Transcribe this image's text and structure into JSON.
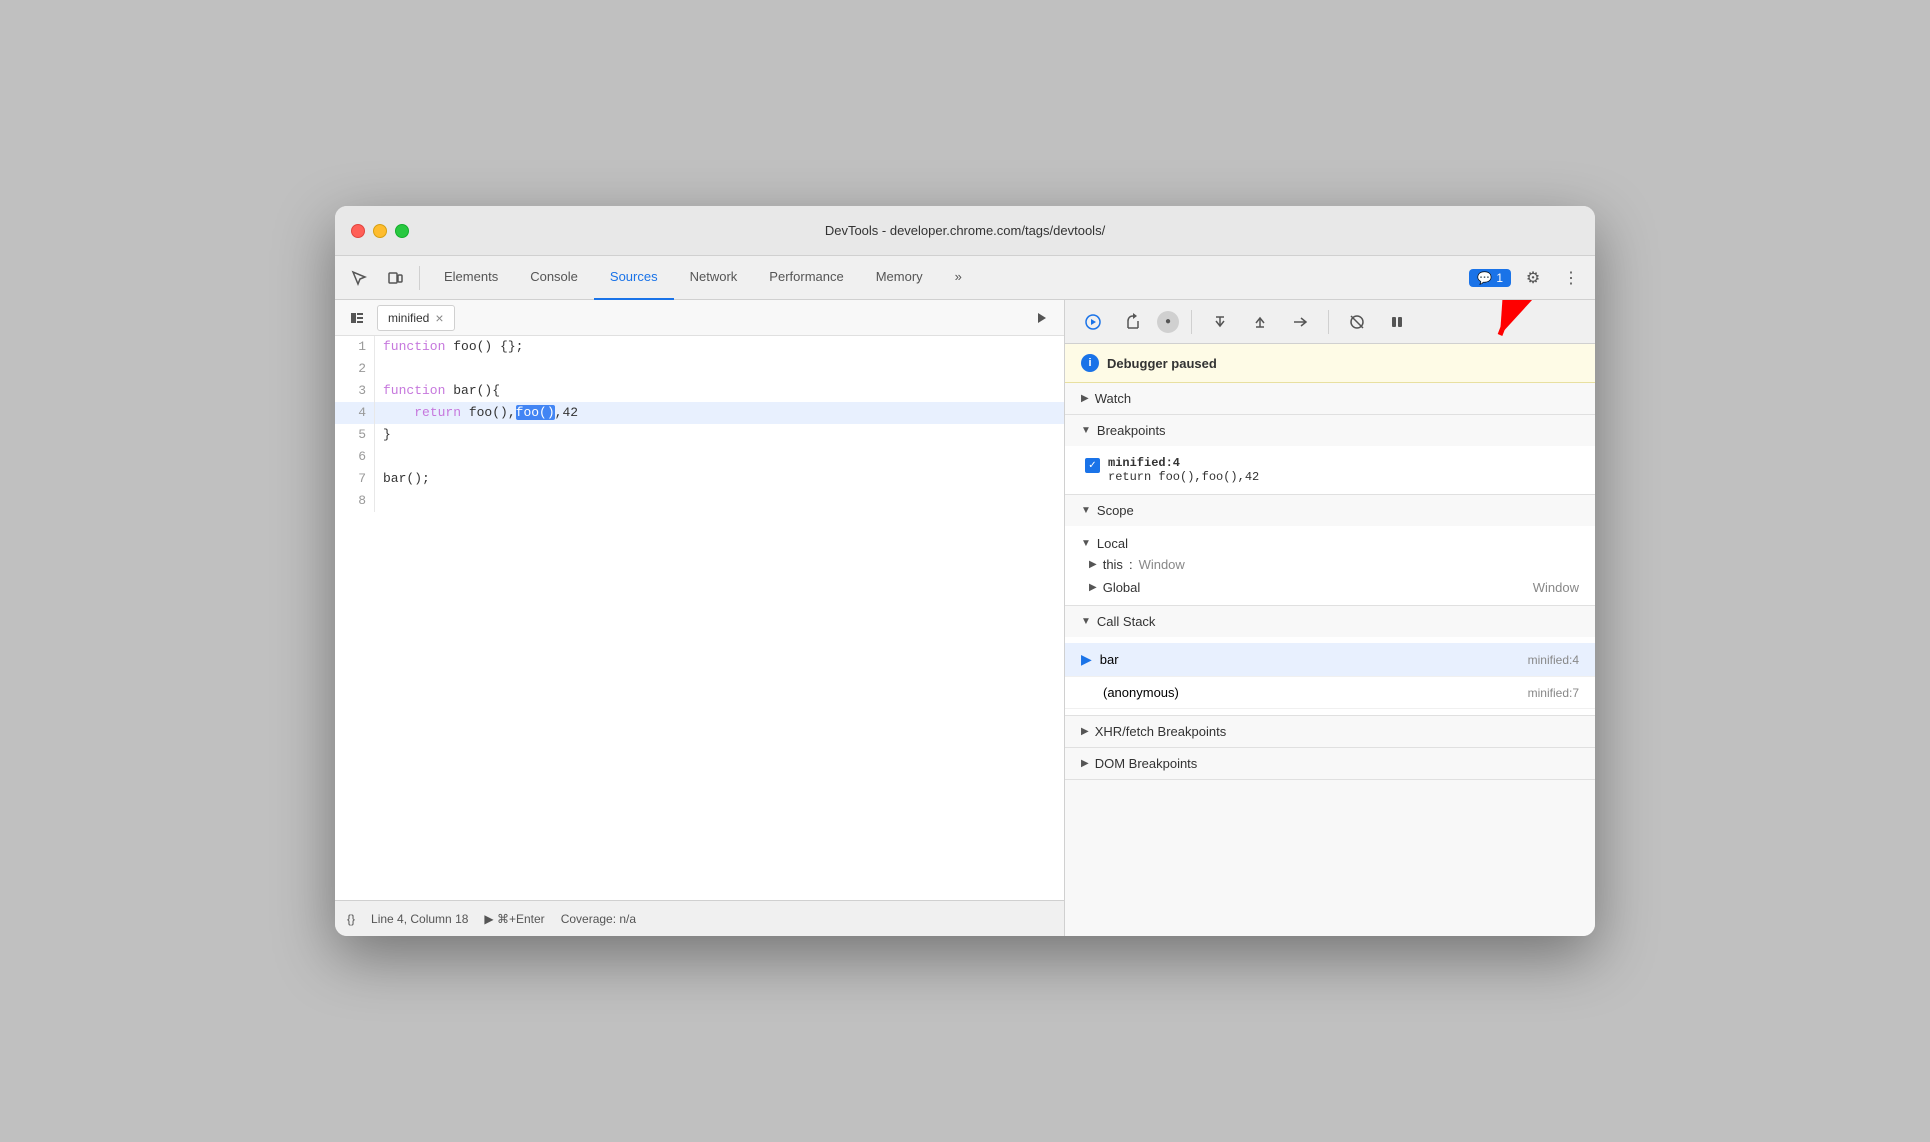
{
  "window": {
    "title": "DevTools - developer.chrome.com/tags/devtools/"
  },
  "traffic_lights": {
    "close": "close",
    "minimize": "minimize",
    "maximize": "maximize"
  },
  "toolbar": {
    "tabs": [
      {
        "id": "elements",
        "label": "Elements",
        "active": false
      },
      {
        "id": "console",
        "label": "Console",
        "active": false
      },
      {
        "id": "sources",
        "label": "Sources",
        "active": true
      },
      {
        "id": "network",
        "label": "Network",
        "active": false
      },
      {
        "id": "performance",
        "label": "Performance",
        "active": false
      },
      {
        "id": "memory",
        "label": "Memory",
        "active": false
      }
    ],
    "more_label": "»",
    "notification_count": "1",
    "settings_label": "⚙",
    "more_options_label": "⋮"
  },
  "left_panel": {
    "file_tab_name": "minified",
    "close_label": "×",
    "code_lines": [
      {
        "num": 1,
        "content": "function foo() {};",
        "highlighted": false
      },
      {
        "num": 2,
        "content": "",
        "highlighted": false
      },
      {
        "num": 3,
        "content": "function bar(){",
        "highlighted": false
      },
      {
        "num": 4,
        "content": "    return foo(),foo(),42",
        "highlighted": true
      },
      {
        "num": 5,
        "content": "}",
        "highlighted": false
      },
      {
        "num": 6,
        "content": "",
        "highlighted": false
      },
      {
        "num": 7,
        "content": "bar();",
        "highlighted": false
      },
      {
        "num": 8,
        "content": "",
        "highlighted": false
      }
    ],
    "status": {
      "pretty_print": "{}",
      "position": "Line 4, Column 18",
      "run_label": "▶ ⌘+Enter",
      "coverage": "Coverage: n/a"
    }
  },
  "right_panel": {
    "debug_buttons": [
      {
        "id": "resume",
        "icon": "▶",
        "active": true
      },
      {
        "id": "step-over",
        "icon": "↺",
        "active": false
      },
      {
        "id": "pause",
        "icon": "⏸",
        "active": false
      },
      {
        "id": "step-into",
        "icon": "↓",
        "active": false
      },
      {
        "id": "step-out",
        "icon": "↑",
        "active": false
      },
      {
        "id": "deactivate",
        "icon": "⊘",
        "active": false
      }
    ],
    "debugger_paused": "Debugger paused",
    "sections": {
      "watch": {
        "label": "Watch",
        "expanded": false
      },
      "breakpoints": {
        "label": "Breakpoints",
        "expanded": true,
        "items": [
          {
            "location": "minified:4",
            "code": "return foo(),foo(),42"
          }
        ]
      },
      "scope": {
        "label": "Scope",
        "expanded": true,
        "local": {
          "label": "Local",
          "items": [
            {
              "key": "this",
              "colon": ":",
              "value": "Window"
            }
          ]
        },
        "global": {
          "label": "Global",
          "value": "Window"
        }
      },
      "call_stack": {
        "label": "Call Stack",
        "expanded": true,
        "frames": [
          {
            "name": "bar",
            "location": "minified:4",
            "active": true
          },
          {
            "name": "(anonymous)",
            "location": "minified:7",
            "active": false
          }
        ]
      },
      "xhr_breakpoints": {
        "label": "XHR/fetch Breakpoints",
        "expanded": false
      },
      "dom_breakpoints": {
        "label": "DOM Breakpoints",
        "expanded": false
      }
    }
  }
}
